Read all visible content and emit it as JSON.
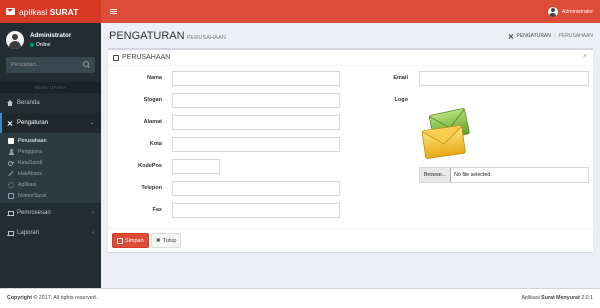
{
  "app": {
    "logo_prefix": "aplikasi",
    "logo_suffix": "SURAT"
  },
  "sidebar": {
    "user_name": "Administrator",
    "user_status": "Online",
    "search_placeholder": "Pencarian...",
    "menu_header": "MENU UTAMA",
    "items": [
      {
        "label": "Beranda",
        "icon": "home-icon"
      },
      {
        "label": "Pengaturan",
        "icon": "wrench-icon",
        "active": true
      },
      {
        "label": "Pemrosesan",
        "icon": "laptop-icon"
      },
      {
        "label": "Laporan",
        "icon": "laptop-icon"
      }
    ],
    "submenu": [
      {
        "label": "Perusahaan",
        "icon": "building-icon",
        "active": true
      },
      {
        "label": "Pengguna",
        "icon": "user-icon"
      },
      {
        "label": "KataSandi",
        "icon": "key-icon"
      },
      {
        "label": "HakAkses",
        "icon": "wrench-icon"
      },
      {
        "label": "Aplikasi",
        "icon": "gear-icon"
      },
      {
        "label": "NomorSurat",
        "icon": "list-icon"
      }
    ]
  },
  "topbar": {
    "user_name": "Administrator"
  },
  "header": {
    "title": "PENGATURAN",
    "subtitle": "PERUSAHAAN",
    "breadcrumb": [
      "PENGATURAN",
      "PERUSAHAAN"
    ]
  },
  "box": {
    "title": "PERUSAHAAN",
    "close": "×",
    "labels": {
      "nama": "Nama",
      "slogan": "Slogan",
      "alamat": "Alamat",
      "kota": "Kota",
      "kodepos": "KodePos",
      "telepon": "Telepon",
      "fax": "Fax",
      "email": "Email",
      "logo": "Logo"
    },
    "values": {
      "nama": "",
      "slogan": "",
      "alamat": "",
      "kota": "",
      "kodepos": "",
      "telepon": "",
      "fax": "",
      "email": ""
    },
    "file_button": "Browse...",
    "file_text": "No file selected.",
    "save_label": "Simpan",
    "close_label": "Tutup"
  },
  "footer": {
    "copyright_bold": "Copyright ©",
    "copyright_rest": " 2017. All rights reserved.",
    "app_prefix": "Aplikasi ",
    "app_name": "Surat Menyurat",
    "version": " 2.0.1"
  }
}
